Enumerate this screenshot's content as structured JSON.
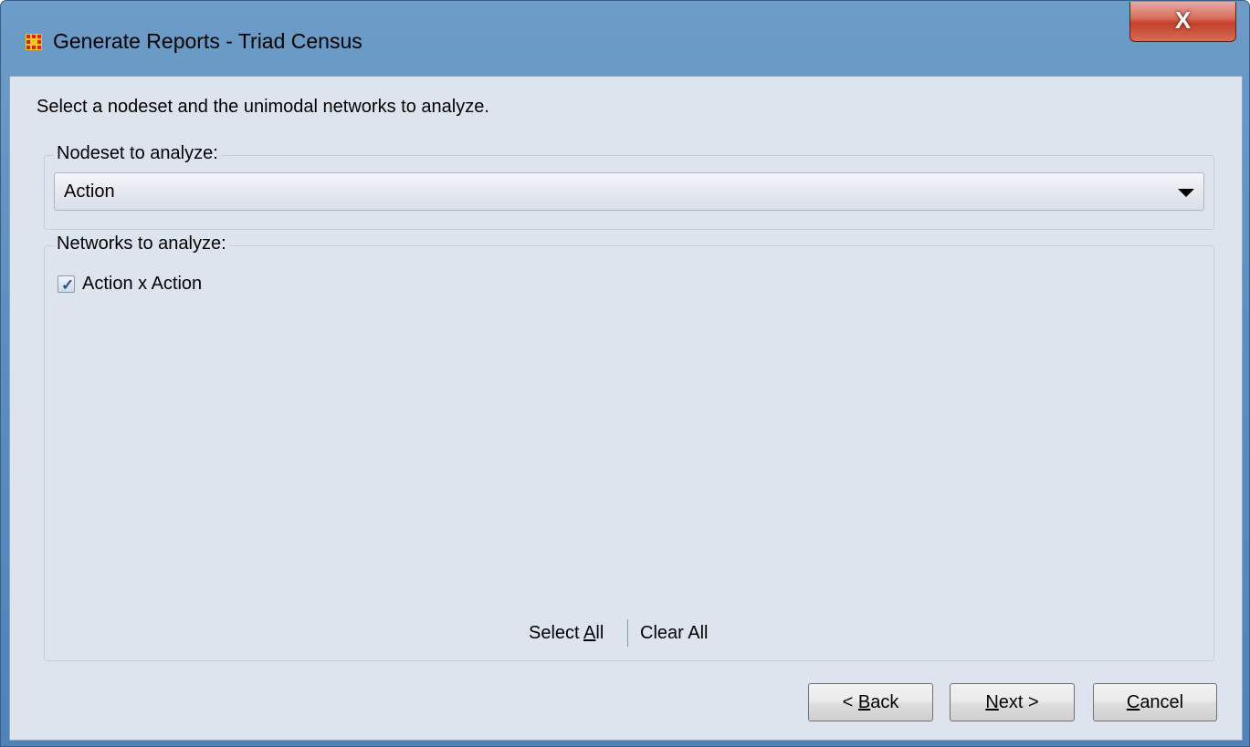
{
  "window": {
    "title": "Generate Reports - Triad Census",
    "close_label": "X"
  },
  "instruction": "Select a nodeset and the unimodal networks to analyze.",
  "nodeset_group": {
    "legend": "Nodeset to analyze:",
    "selected": "Action"
  },
  "networks_group": {
    "legend": "Networks to analyze:",
    "items": [
      {
        "label": "Action x Action",
        "checked": true
      }
    ],
    "select_all_label": "Select All",
    "clear_all_label": "Clear All"
  },
  "buttons": {
    "back": "< Back",
    "next": "Next >",
    "cancel": "Cancel"
  },
  "colors": {
    "titlebar": "#5d8fc0",
    "client_bg": "#dce4ee",
    "close_button": "#c4402a",
    "app_icon_red": "#d6241a",
    "app_icon_yellow": "#f2c521"
  },
  "icons": {
    "app": "app-grid-icon",
    "close": "close-icon",
    "dropdown": "chevron-down-icon",
    "check": "check-icon"
  }
}
